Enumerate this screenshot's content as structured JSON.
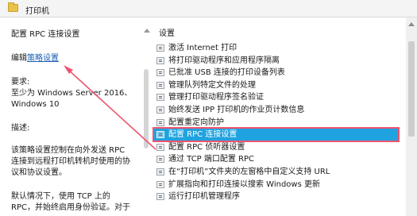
{
  "header": {
    "folder_name": "打印机"
  },
  "left": {
    "policy_title": "配置 RPC 连接设置",
    "edit_prefix": "编辑",
    "edit_link": "策略设置",
    "req_label": "要求:",
    "req_line1": "至少为 Windows Server 2016、",
    "req_line2": "Windows 10",
    "desc_label": "描述:",
    "desc_line1": "该策略设置控制在向外发送 RPC",
    "desc_line2": "连接到远程打印机转机时使用的协",
    "desc_line3": "议和协议设置。",
    "desc_line4": "默认情况下，使用 TCP 上的",
    "desc_line5": "RPC，并始终启用身份验证。对于"
  },
  "right": {
    "column_header": "设置",
    "items": [
      "激活 Internet 打印",
      "将打印驱动程序和应用程序隔离",
      "已批准 USB 连接的打印设备列表",
      "管理队列特定文件的处理",
      "管理打印驱动程序签名验证",
      "始终发送 IPP 打印机的作业页计数信息",
      "配置重定向防护",
      "配置 RPC 连接设置",
      "配置 RPC 侦听器设置",
      "通过 TCP 端口配置 RPC",
      "在“打印机”文件夹的左窗格中自定义支持 URL",
      "扩展指向和打印连接以搜索 Windows 更新",
      "运行打印机管理程序"
    ],
    "selected_index": 7
  },
  "colors": {
    "selection": "#1fa3e0",
    "highlight_border": "#ee5470",
    "annotation_arrow": "#ee5470",
    "link": "#1a5fb4"
  }
}
